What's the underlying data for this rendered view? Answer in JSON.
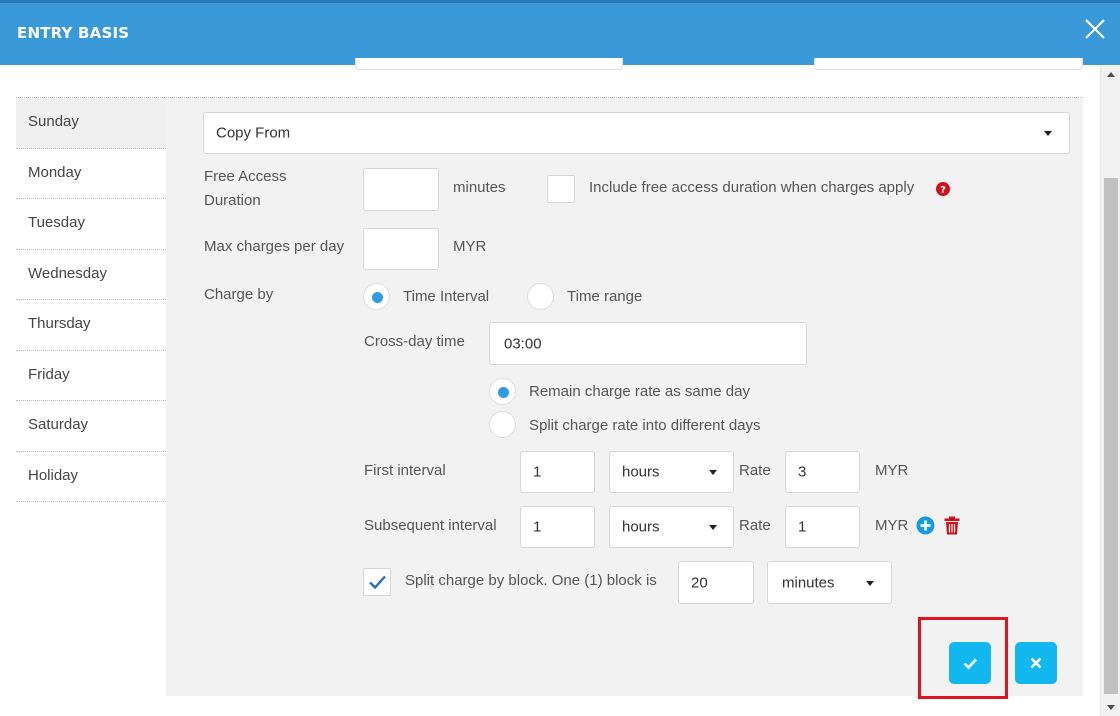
{
  "header": {
    "title": "ENTRY BASIS"
  },
  "sidebar": {
    "days": [
      {
        "label": "Sunday",
        "active": true
      },
      {
        "label": "Monday",
        "active": false
      },
      {
        "label": "Tuesday",
        "active": false
      },
      {
        "label": "Wednesday",
        "active": false
      },
      {
        "label": "Thursday",
        "active": false
      },
      {
        "label": "Friday",
        "active": false
      },
      {
        "label": "Saturday",
        "active": false
      },
      {
        "label": "Holiday",
        "active": false
      }
    ]
  },
  "form": {
    "copy_from": {
      "value": "Copy From"
    },
    "free_access": {
      "label_line1": "Free Access",
      "label_line2": "Duration",
      "value": "",
      "unit": "minutes",
      "include_label": "Include free access duration when charges apply",
      "include_checked": false
    },
    "max_charges": {
      "label": "Max charges per day",
      "value": "",
      "unit": "MYR"
    },
    "charge_by": {
      "label": "Charge by",
      "options": [
        {
          "label": "Time Interval",
          "selected": true
        },
        {
          "label": "Time range",
          "selected": false
        }
      ]
    },
    "cross_day": {
      "label": "Cross-day time",
      "value": "03:00",
      "options": [
        {
          "label": "Remain charge rate as same day",
          "selected": true
        },
        {
          "label": "Split charge rate into different days",
          "selected": false
        }
      ]
    },
    "first_interval": {
      "label": "First interval",
      "value": "1",
      "unit": "hours",
      "rate_label": "Rate",
      "rate": "3",
      "currency": "MYR"
    },
    "subsequent_interval": {
      "label": "Subsequent interval",
      "value": "1",
      "unit": "hours",
      "rate_label": "Rate",
      "rate": "1",
      "currency": "MYR"
    },
    "split_block": {
      "checked": true,
      "label": "Split charge by block. One (1) block is",
      "value": "20",
      "unit": "minutes"
    }
  },
  "colors": {
    "header": "#3a9ad9",
    "accent": "#12b7ef",
    "radio": "#2f9be0",
    "help_icon": "#d0101a",
    "delete_icon": "#d0101a",
    "highlight_box": "#e0141e"
  },
  "icons": [
    "close-icon",
    "chevron-down-icon",
    "help-icon",
    "add-circle-icon",
    "trash-icon",
    "check-icon",
    "x-icon"
  ]
}
